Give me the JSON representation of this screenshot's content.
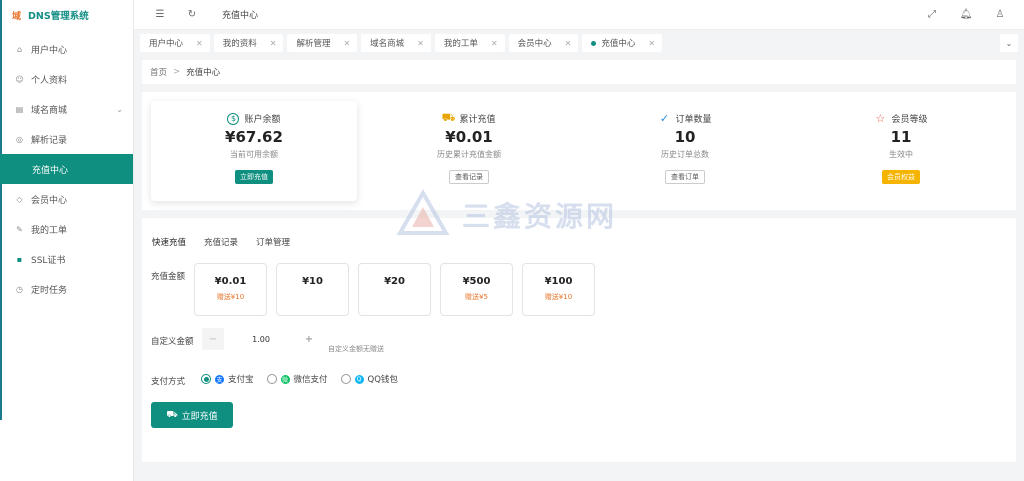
{
  "app": {
    "logo_mark": "域",
    "name": "DNS管理系统"
  },
  "sidebar": {
    "items": [
      {
        "label": "用户中心",
        "icon": "home-icon"
      },
      {
        "label": "个人资料",
        "icon": "user-icon"
      },
      {
        "label": "域名商城",
        "icon": "shop-icon",
        "has_arrow": true
      },
      {
        "label": "解析记录",
        "icon": "record-icon"
      },
      {
        "label": "充值中心",
        "icon": "wallet-icon",
        "active": true
      },
      {
        "label": "会员中心",
        "icon": "diamond-icon"
      },
      {
        "label": "我的工单",
        "icon": "ticket-icon"
      },
      {
        "label": "SSL证书",
        "icon": "lock-icon"
      },
      {
        "label": "定时任务",
        "icon": "clock-icon"
      }
    ]
  },
  "header": {
    "title": "充值中心"
  },
  "tabs": [
    {
      "label": "用户中心"
    },
    {
      "label": "我的资料"
    },
    {
      "label": "解析管理"
    },
    {
      "label": "域名商城"
    },
    {
      "label": "我的工单"
    },
    {
      "label": "会员中心"
    },
    {
      "label": "充值中心",
      "active": true
    }
  ],
  "breadcrumb": {
    "home": "首页",
    "sep": ">",
    "current": "充值中心"
  },
  "stats": [
    {
      "title": "账户余额",
      "value": "¥67.62",
      "sub": "当前可用余额",
      "button": "立即充值",
      "accent": "#0f8f80"
    },
    {
      "title": "累计充值",
      "value": "¥0.01",
      "sub": "历史累计充值金额",
      "button": "查看记录",
      "accent": "#e8a400"
    },
    {
      "title": "订单数量",
      "value": "10",
      "sub": "历史订单总数",
      "button": "查看订单",
      "accent": "#2a8fd6"
    },
    {
      "title": "会员等级",
      "value": "11",
      "sub": "生效中",
      "button": "会员权益",
      "accent": "#e85a4a"
    }
  ],
  "recharge": {
    "subtabs": [
      "快速充值",
      "充值记录",
      "订单管理"
    ],
    "amount_label": "充值金额",
    "amounts": [
      {
        "value": "¥0.01",
        "gift": "赠送¥10"
      },
      {
        "value": "¥10",
        "gift": ""
      },
      {
        "value": "¥20",
        "gift": ""
      },
      {
        "value": "¥500",
        "gift": "赠送¥5"
      },
      {
        "value": "¥100",
        "gift": "赠送¥10"
      }
    ],
    "custom_label": "自定义金额",
    "custom_value": "1.00",
    "minus": "−",
    "plus": "+",
    "custom_hint": "自定义金额无赠送",
    "pay_label": "支付方式",
    "pay_methods": [
      {
        "label": "支付宝",
        "selected": true,
        "color": "#1677ff"
      },
      {
        "label": "微信支付",
        "selected": false,
        "color": "#07c160"
      },
      {
        "label": "QQ钱包",
        "selected": false,
        "color": "#12b7f5"
      }
    ],
    "submit": "立即充值"
  },
  "watermark": {
    "text": "三鑫资源网"
  }
}
